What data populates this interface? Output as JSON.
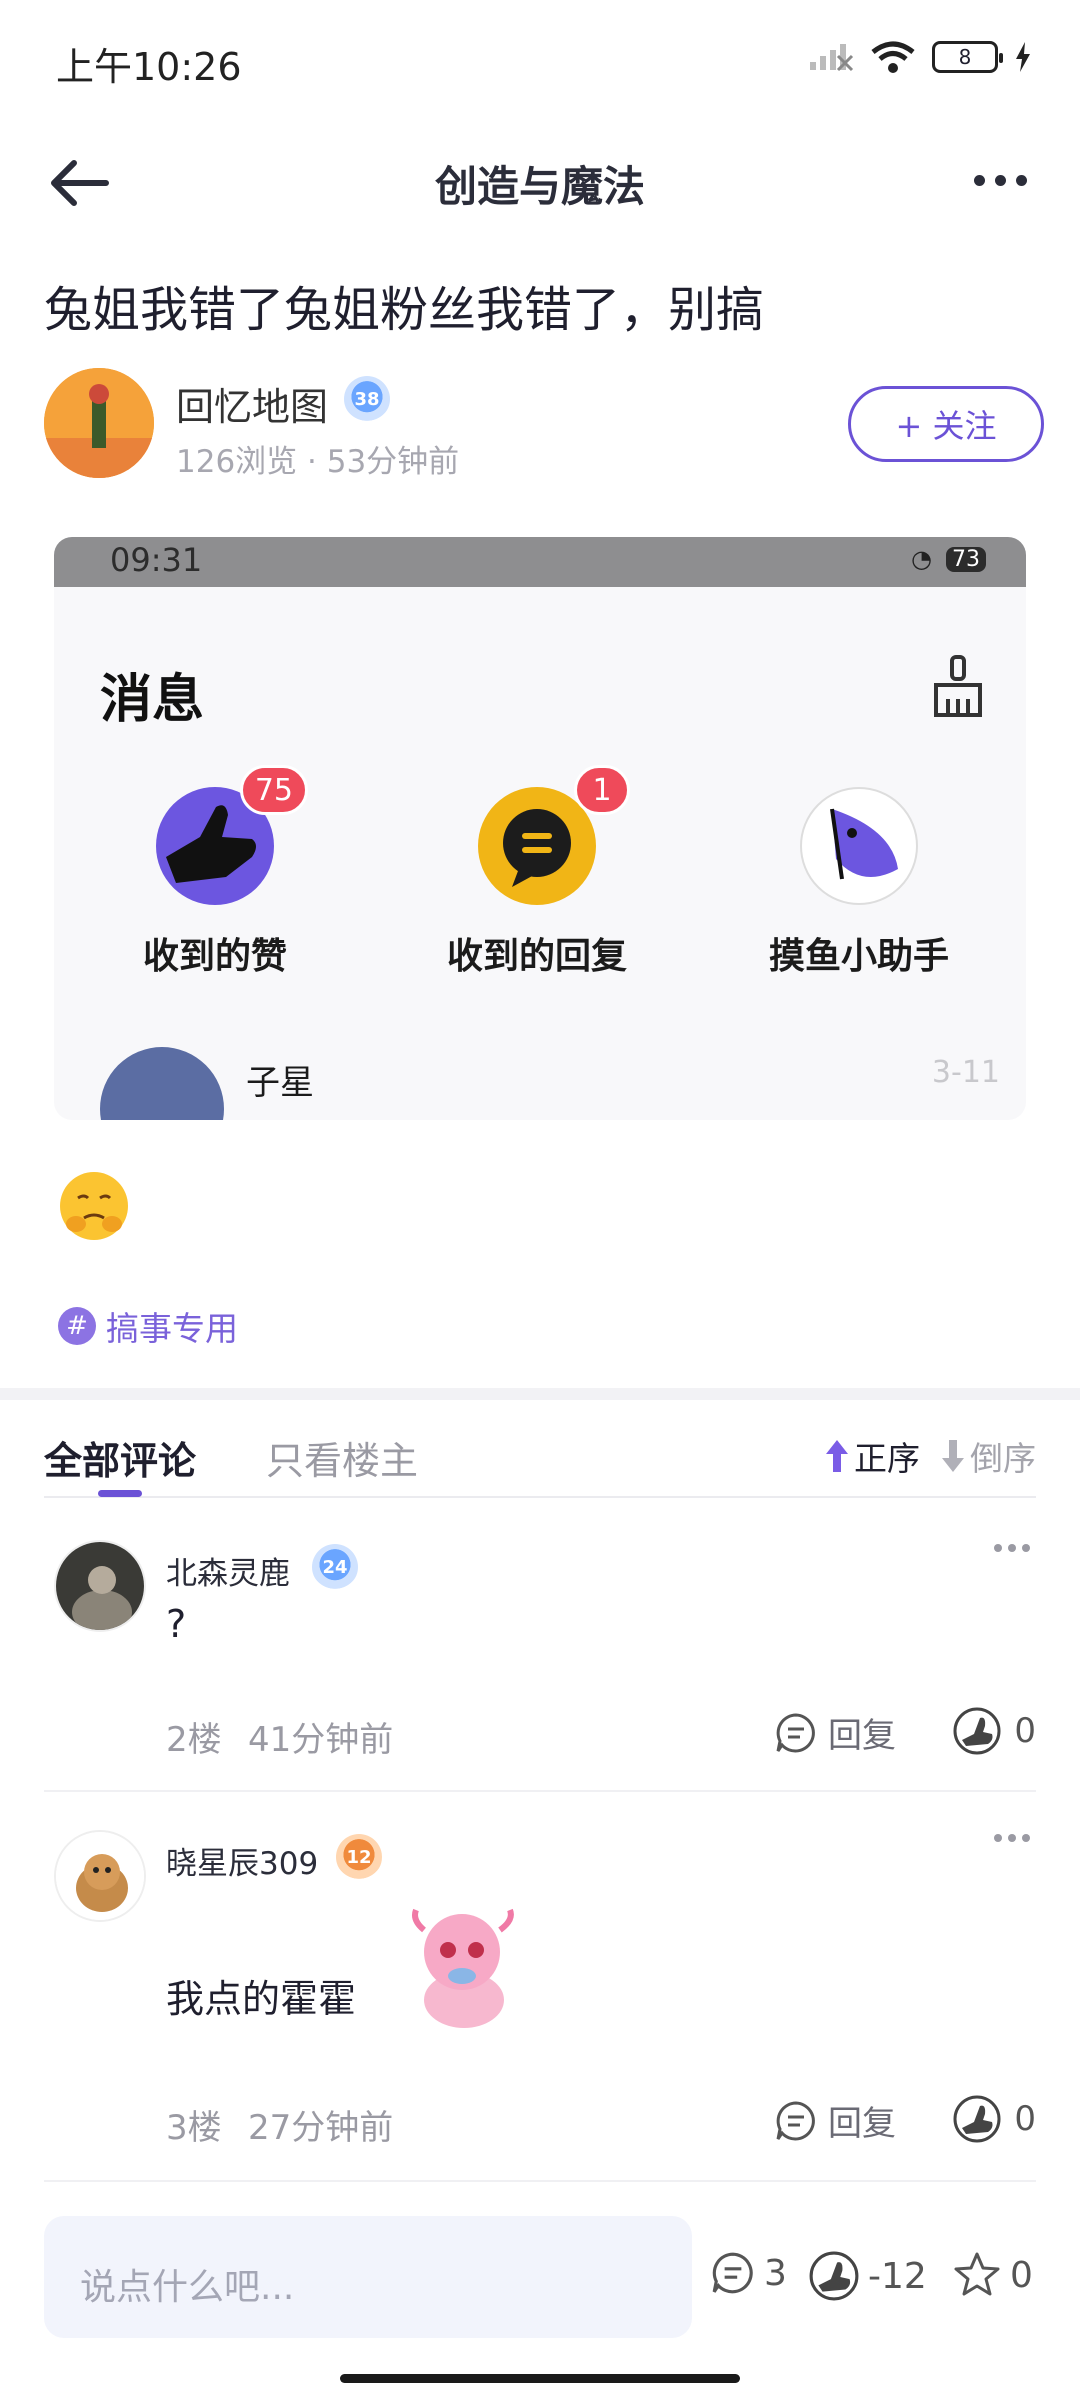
{
  "status_bar": {
    "time": "上午10:26",
    "battery": "8"
  },
  "nav": {
    "title": "创造与魔法"
  },
  "post": {
    "title": "兔姐我错了兔姐粉丝我错了，别搞",
    "author": {
      "name": "回忆地图",
      "level": "38",
      "meta": "126浏览 · 53分钟前"
    },
    "follow_label": "+ 关注",
    "topic": "搞事专用"
  },
  "embedded_screenshot": {
    "time": "09:31",
    "battery": "73",
    "title": "消息",
    "items": [
      {
        "label": "收到的赞",
        "badge": "75"
      },
      {
        "label": "收到的回复",
        "badge": "1"
      },
      {
        "label": "摸鱼小助手",
        "badge": ""
      }
    ],
    "row": {
      "name": "子星",
      "date": "3-11"
    }
  },
  "comments_tabs": {
    "all": "全部评论",
    "owner_only": "只看楼主",
    "sort_asc": "正序",
    "sort_desc": "倒序"
  },
  "comments": [
    {
      "name": "北森灵鹿",
      "level": "24",
      "text": "?",
      "floor": "2楼",
      "time": "41分钟前",
      "reply_label": "回复",
      "likes": "0"
    },
    {
      "name": "晓星辰309",
      "level": "12",
      "text": "我点的霍霍",
      "floor": "3楼",
      "time": "27分钟前",
      "reply_label": "回复",
      "likes": "0"
    }
  ],
  "bottom_bar": {
    "placeholder": "说点什么吧...",
    "comment_count": "3",
    "like_count": "-12",
    "fav_count": "0"
  },
  "colors": {
    "accent": "#6b52d6",
    "badge_red": "#ef4a5a",
    "level_blue": "#6aa5ff",
    "level_orange": "#f08a3c"
  }
}
